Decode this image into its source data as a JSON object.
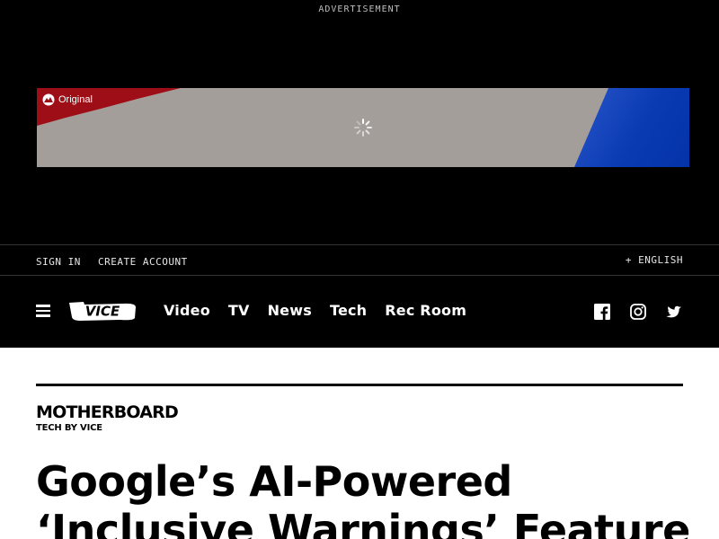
{
  "ad": {
    "label": "ADVERTISEMENT",
    "brand_text": "Original",
    "colors": {
      "red": "#9e0e16",
      "gray": "#a49e9b",
      "blue": "#0a3bb3"
    }
  },
  "account_bar": {
    "sign_in": "SIGN IN",
    "create_account": "CREATE ACCOUNT",
    "language": "+ ENGLISH"
  },
  "nav": {
    "logo": "VICE",
    "links": [
      "Video",
      "TV",
      "News",
      "Tech",
      "Rec Room"
    ],
    "social_icons": [
      "facebook-icon",
      "instagram-icon",
      "twitter-icon"
    ]
  },
  "article": {
    "section_logo": "MOTHERBOARD",
    "section_tagline": "TECH BY VICE",
    "headline": "Google’s AI-Powered ‘Inclusive Warnings’ Feature"
  }
}
